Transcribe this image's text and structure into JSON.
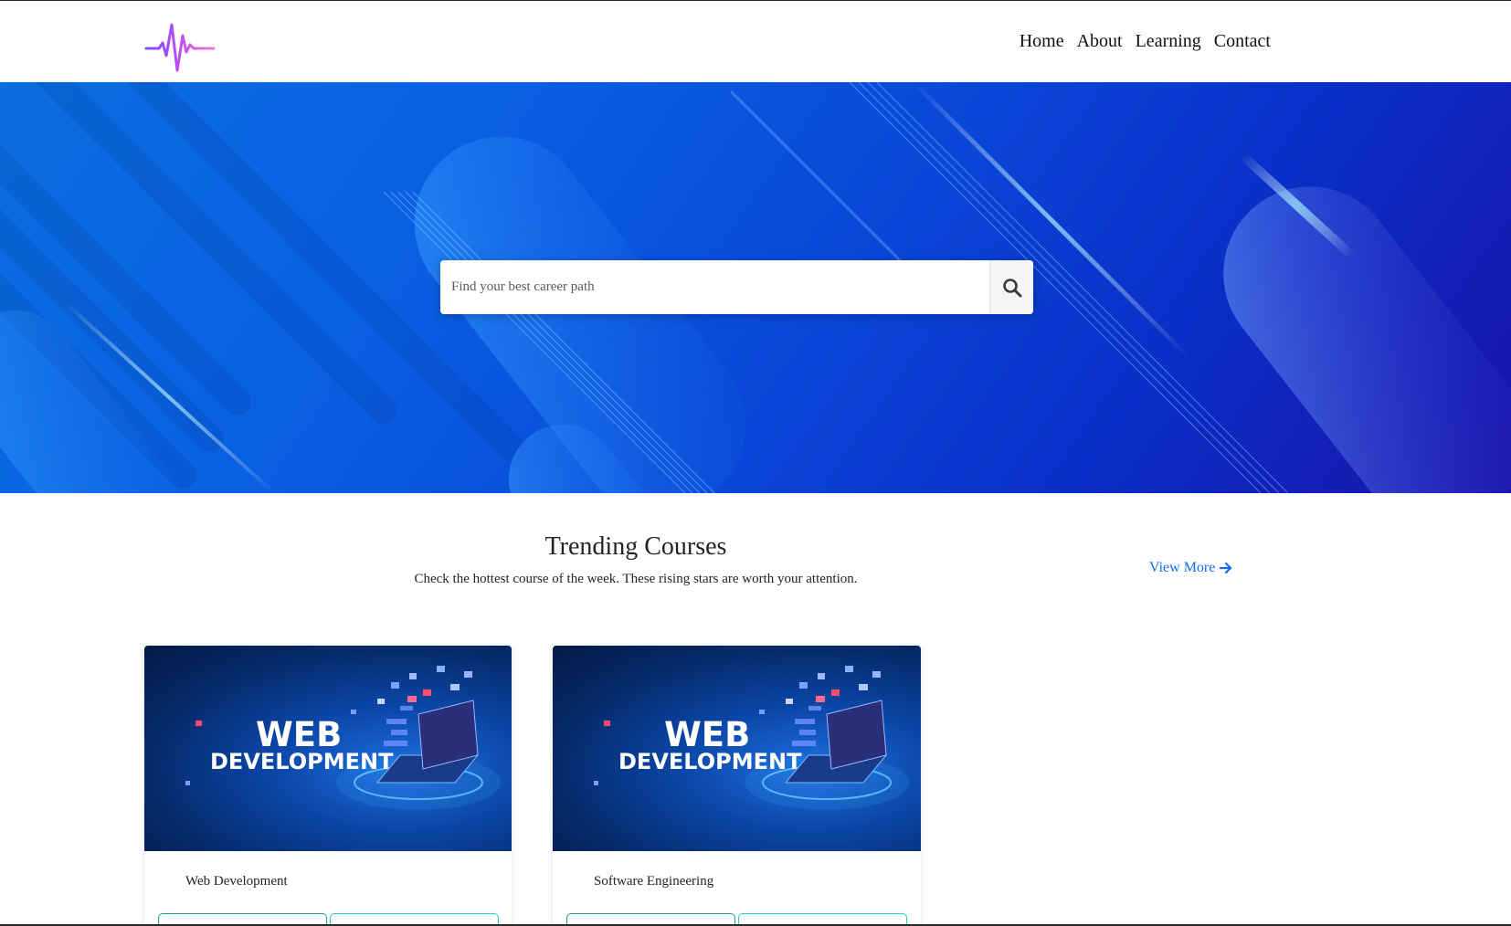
{
  "header": {
    "logo_icon": "pulse-wave-logo",
    "nav": [
      {
        "label": "Home"
      },
      {
        "label": "About"
      },
      {
        "label": "Learning"
      },
      {
        "label": "Contact"
      }
    ]
  },
  "hero": {
    "search": {
      "placeholder": "Find your best career path",
      "value": "",
      "icon": "search-icon"
    }
  },
  "trending": {
    "title": "Trending Courses",
    "subtitle": "Check the hottest course of the week. These rising stars are worth your attention.",
    "view_more_label": "View More",
    "view_more_icon": "arrow-right-icon",
    "courses": [
      {
        "title": "Web Development",
        "image_line1": "WEB",
        "image_line2": "DEVELOPMENT"
      },
      {
        "title": "Software Engineering",
        "image_line1": "WEB",
        "image_line2": "DEVELOPMENT"
      }
    ]
  },
  "colors": {
    "link": "#0d6efd",
    "hero_primary": "#0a5fe3",
    "hero_deep": "#1a12a8",
    "button_green_border": "#1aa088",
    "button_cyan_border": "#22c7e8"
  }
}
